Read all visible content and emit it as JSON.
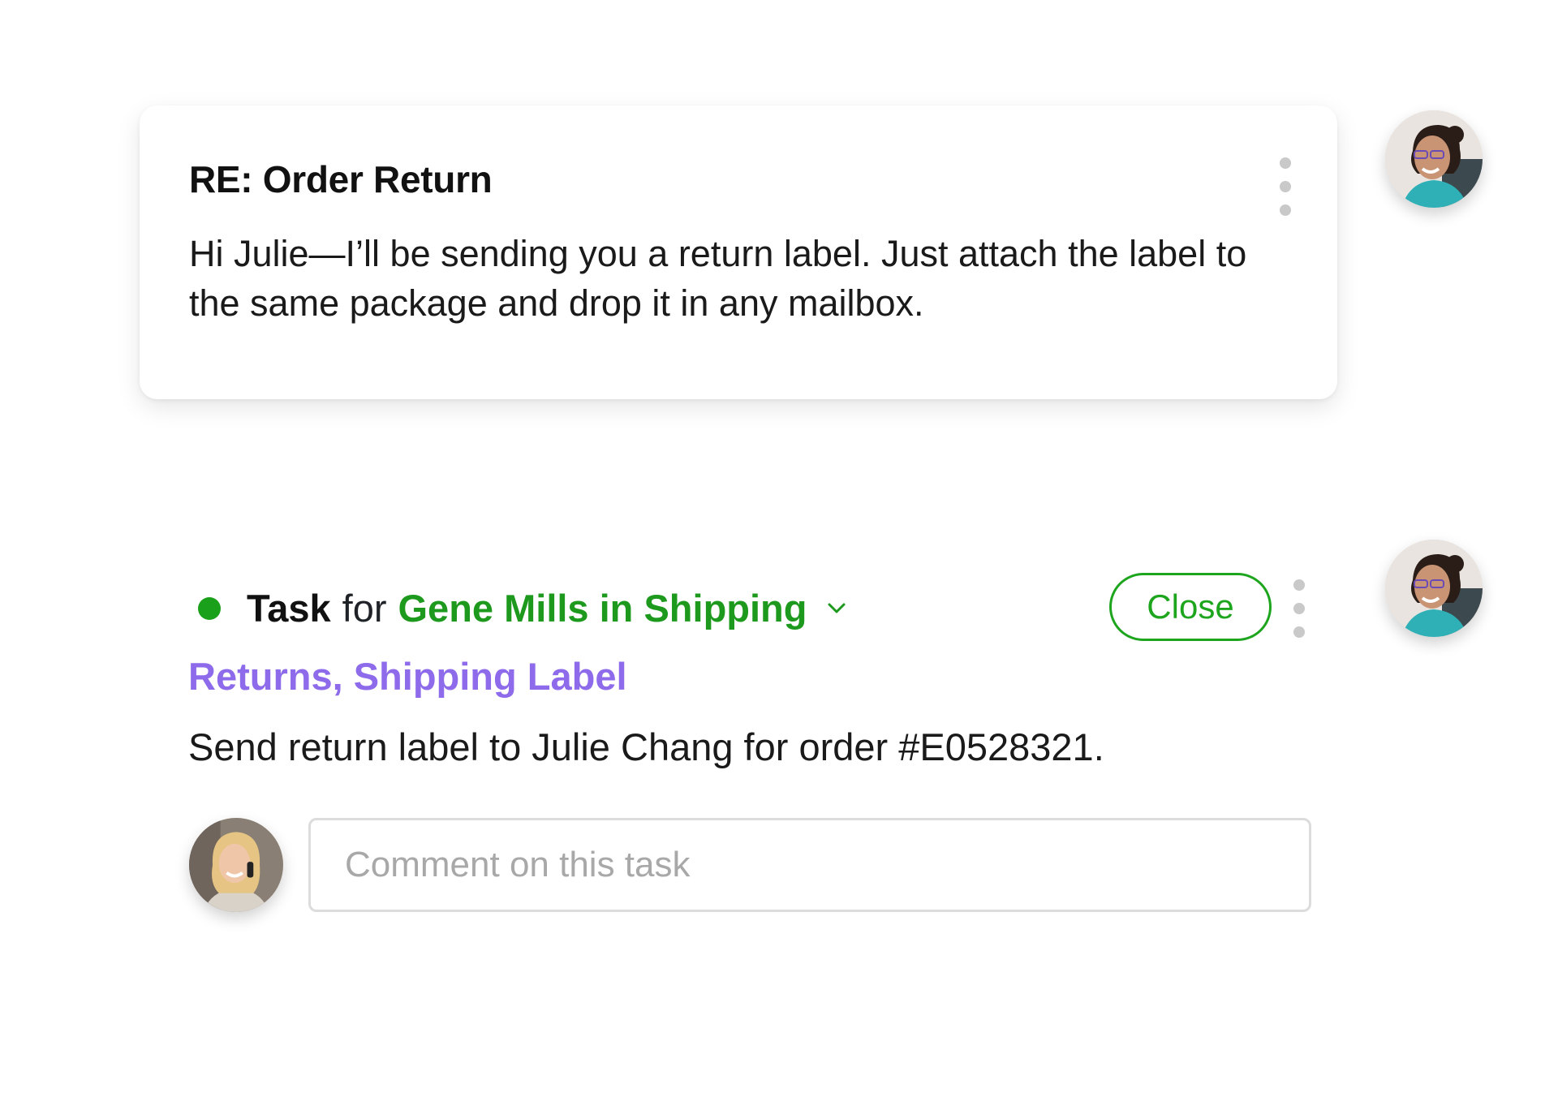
{
  "message": {
    "subject": "RE: Order Return",
    "body": "Hi Julie—I’ll be sending you a return label. Just attach the label to the same package and drop it in any mailbox."
  },
  "task": {
    "title_word": "Task",
    "for_word": "for",
    "assignee": "Gene Mills in Shipping",
    "close_label": "Close",
    "tags": "Returns, Shipping Label",
    "description": "Send return label to Julie Chang for order #E0528321.",
    "status_color": "#1aa01a"
  },
  "comment": {
    "placeholder": "Comment on this task"
  },
  "colors": {
    "accent_green": "#1ea51e",
    "tag_purple": "#8d6bea"
  }
}
